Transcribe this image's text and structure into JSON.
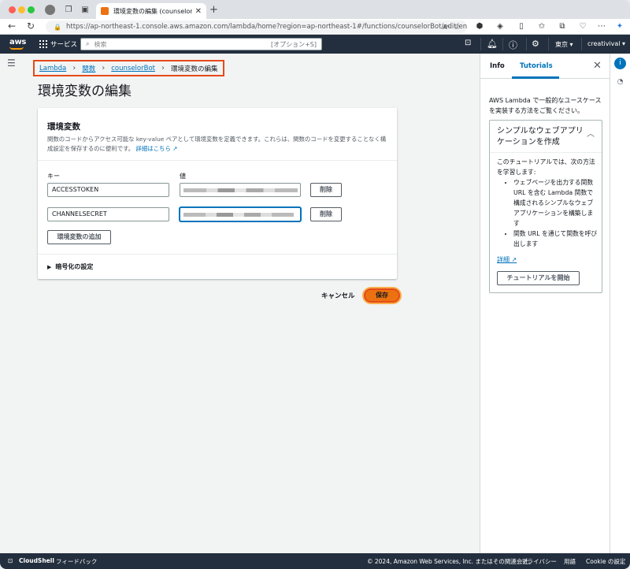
{
  "browser": {
    "tab_title": "環境変数の編集 (counselorBot)",
    "tab_close": "✕",
    "new_tab": "+",
    "url": "https://ap-northeast-1.console.aws.amazon.com/lambda/home?region=ap-northeast-1#/functions/counselorBot/edit/en...",
    "reader_label": "Aᴬ"
  },
  "aws_header": {
    "logo": "aws",
    "services_label": "サービス",
    "search_placeholder": "検索",
    "search_shortcut": "[オプション+S]",
    "region": "東京 ▾",
    "account": "creativival ▾"
  },
  "breadcrumb": {
    "items": [
      "Lambda",
      "関数",
      "counselorBot"
    ],
    "current": "環境変数の編集"
  },
  "page_title": "環境変数の編集",
  "env_panel": {
    "heading": "環境変数",
    "description": "関数のコードからアクセス可能な key-value ペアとして環境変数を定義できます。これらは、関数のコードを変更することなく構成設定を保存するのに便利です。",
    "learn_more": "詳細はこちら",
    "key_label": "キー",
    "value_label": "値",
    "rows": [
      {
        "key": "ACCESSTOKEN",
        "remove_label": "削除"
      },
      {
        "key": "CHANNELSECRET",
        "remove_label": "削除"
      }
    ],
    "add_label": "環境変数の追加",
    "encryption_label": "暗号化の設定"
  },
  "actions": {
    "cancel_label": "キャンセル",
    "save_label": "保存"
  },
  "help_panel": {
    "tab_info": "Info",
    "tab_tutorials": "Tutorials",
    "intro": "AWS Lambda で一般的なユースケースを実装する方法をご覧ください。",
    "card_title": "シンプルなウェブアプリケーションを作成",
    "card_text": "このチュートリアルでは、次の方法を学習します:",
    "bullets": [
      "ウェブページを出力する関数 URL を含む Lambda 関数で構成されるシンプルなウェブアプリケーションを構築します",
      "関数 URL を通じて関数を呼び出します"
    ],
    "details_link": "詳細",
    "start_button": "チュートリアルを開始"
  },
  "footer": {
    "cloudshell": "CloudShell",
    "feedback": "フィードバック",
    "copyright": "© 2024, Amazon Web Services, Inc. またはその関連会社。",
    "privacy": "プライバシー",
    "terms": "用語",
    "cookie": "Cookie の設定"
  },
  "colors": {
    "aws_dark": "#232f3e",
    "link": "#0073bb",
    "primary": "#ec7211",
    "highlight": "#e64a19"
  }
}
